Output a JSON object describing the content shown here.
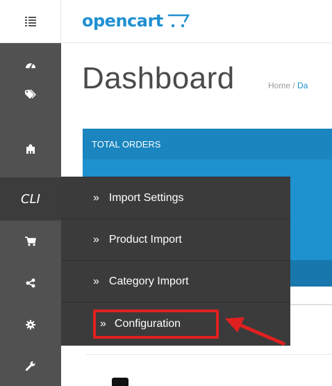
{
  "header": {
    "logo_text": "opencart",
    "menu_icon": "list-icon"
  },
  "sidebar": {
    "items": [
      {
        "icon": "tachometer-icon"
      },
      {
        "icon": "tags-icon"
      },
      {
        "icon": "puzzle-icon"
      },
      {
        "label": "CLI",
        "active": true
      },
      {
        "icon": "shopping-cart-icon"
      },
      {
        "icon": "share-icon"
      },
      {
        "icon": "cog-icon"
      },
      {
        "icon": "wrench-icon"
      }
    ]
  },
  "page": {
    "title": "Dashboard",
    "breadcrumb": {
      "home": "Home",
      "separator": "/",
      "current": "Da"
    }
  },
  "tile": {
    "title": "TOTAL ORDERS"
  },
  "dropdown": {
    "items": [
      {
        "chevron": "»",
        "label": "Import Settings"
      },
      {
        "chevron": "»",
        "label": "Product Import"
      },
      {
        "chevron": "»",
        "label": "Category Import"
      },
      {
        "chevron": "»",
        "label": "Configuration",
        "highlighted": true
      }
    ]
  },
  "colors": {
    "brand": "#1f90d1",
    "sidebar": "#515151",
    "dropdown": "#3b3b3b",
    "highlight": "#e02020"
  }
}
